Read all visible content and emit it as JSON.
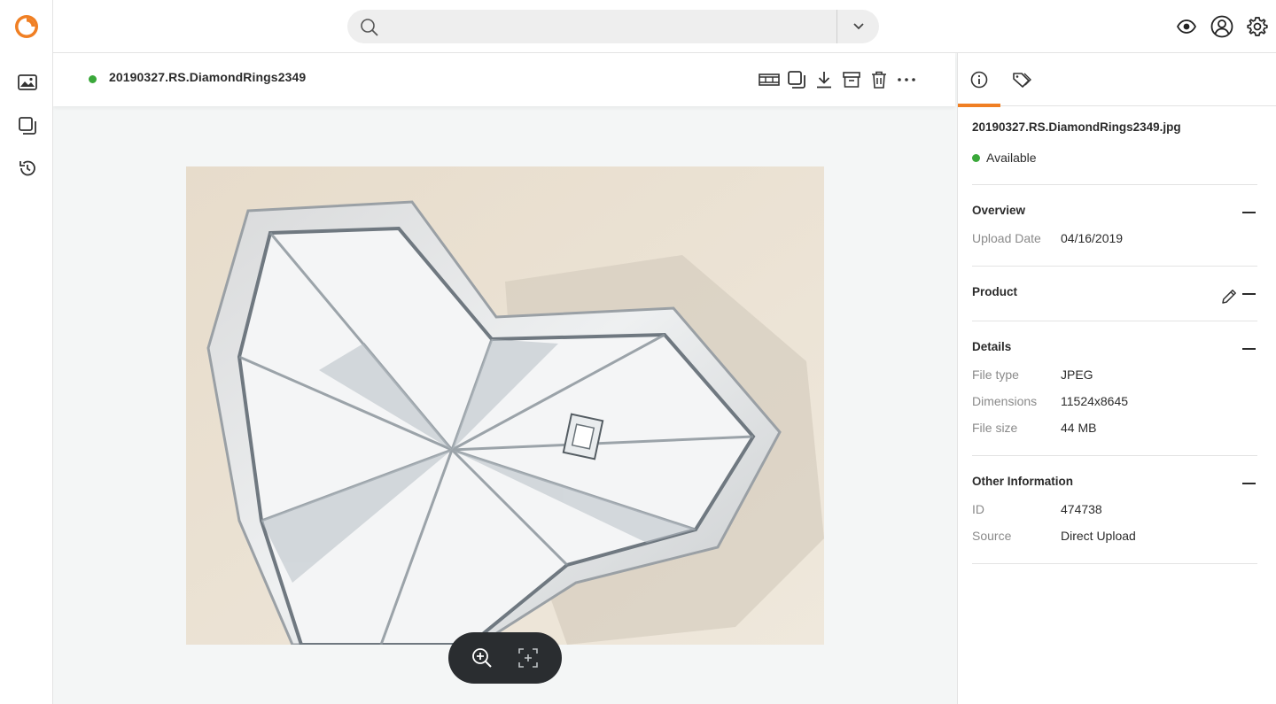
{
  "search": {
    "placeholder": "",
    "value": ""
  },
  "viewer": {
    "title": "20190327.RS.DiamondRings2349",
    "status_color": "#3aa83a"
  },
  "panel": {
    "file_name": "20190327.RS.DiamondRings2349.jpg",
    "status": "Available",
    "overview": {
      "title": "Overview",
      "upload_date_label": "Upload Date",
      "upload_date": "04/16/2019"
    },
    "product": {
      "title": "Product"
    },
    "details": {
      "title": "Details",
      "file_type_label": "File type",
      "file_type": "JPEG",
      "dimensions_label": "Dimensions",
      "dimensions": "11524x8645",
      "file_size_label": "File size",
      "file_size": "44 MB"
    },
    "other": {
      "title": "Other Information",
      "id_label": "ID",
      "id": "474738",
      "source_label": "Source",
      "source": "Direct Upload"
    }
  },
  "icons": {
    "logo": "brand-logo-icon",
    "rail": [
      "assets-icon",
      "collections-icon",
      "history-icon"
    ],
    "top": [
      "eye-icon",
      "user-icon",
      "gear-icon"
    ],
    "actions": [
      "filmstrip-icon",
      "copy-icon",
      "download-icon",
      "archive-icon",
      "trash-icon",
      "more-icon"
    ],
    "zoom": [
      "zoom-in-icon",
      "fit-screen-icon"
    ],
    "tabs": [
      "info-icon",
      "tag-icon"
    ]
  },
  "colors": {
    "accent": "#f07f23",
    "status_green": "#3aa83a",
    "zoom_bar": "#2a2d30"
  }
}
